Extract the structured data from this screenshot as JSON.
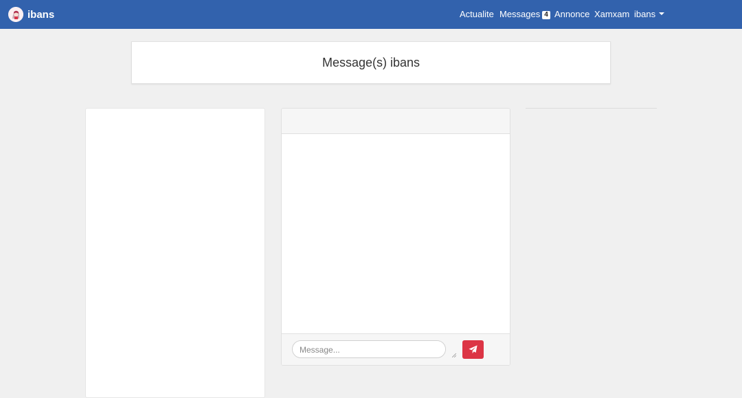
{
  "navbar": {
    "brand": {
      "name": "ibans",
      "logo_icon": "avatar-logo-icon"
    },
    "links": [
      {
        "label": "Actualite"
      },
      {
        "label": "Messages",
        "badge": "4"
      },
      {
        "label": "Annonce"
      },
      {
        "label": "Xamxam"
      }
    ],
    "user_menu": {
      "label": "ibans",
      "icon": "caret-down-icon"
    },
    "bg_color": "#3262ad"
  },
  "page": {
    "title": "Message(s) ibans",
    "background_color": "#f0f0f0"
  },
  "chat": {
    "input": {
      "placeholder": "Message...",
      "value": ""
    },
    "send_button": {
      "icon": "paper-plane-icon",
      "color": "#dc3545"
    }
  }
}
